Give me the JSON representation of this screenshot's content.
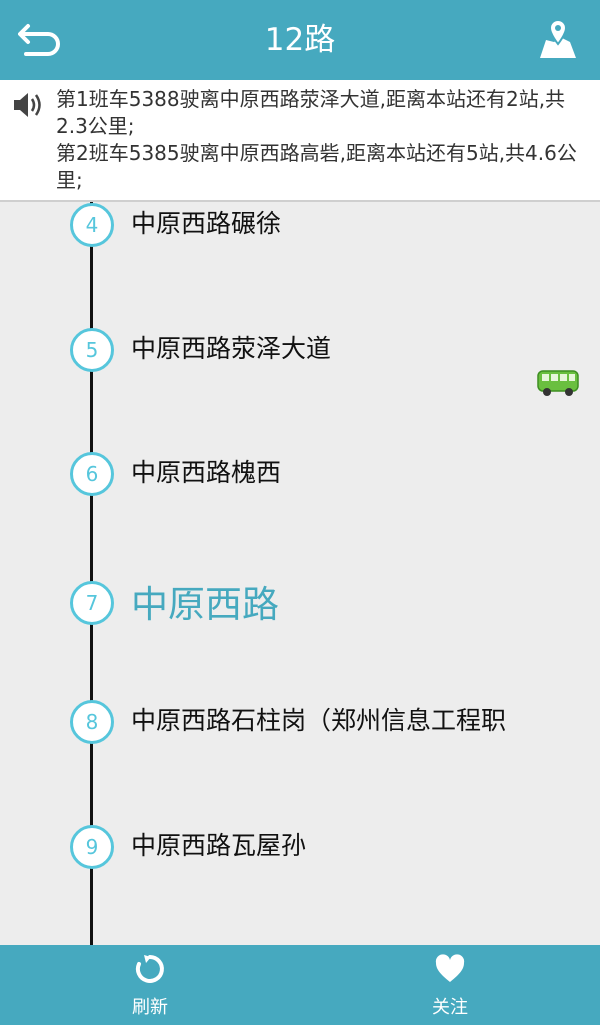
{
  "header": {
    "title": "12路",
    "back_icon": "back-arrow-icon",
    "map_icon": "map-pin-icon"
  },
  "notice": {
    "speaker_icon": "speaker-icon",
    "line1": "第1班车5388驶离中原西路荥泽大道,距离本站还有2站,共2.3公里;",
    "line2": "第2班车5385驶离中原西路高砦,距离本站还有5站,共4.6公里;"
  },
  "stops": [
    {
      "num": "4",
      "name": "中原西路碾徐"
    },
    {
      "num": "5",
      "name": "中原西路荥泽大道"
    },
    {
      "num": "6",
      "name": "中原西路槐西"
    },
    {
      "num": "7",
      "name": "中原西路"
    },
    {
      "num": "8",
      "name": "中原西路石柱岗（郑州信息工程职"
    },
    {
      "num": "9",
      "name": "中原西路瓦屋孙"
    }
  ],
  "bus_icon": "bus-icon",
  "footer": {
    "refresh_label": "刷新",
    "follow_label": "关注"
  },
  "colors": {
    "accent": "#46a9bf",
    "stop_circle": "#56c6dc"
  }
}
